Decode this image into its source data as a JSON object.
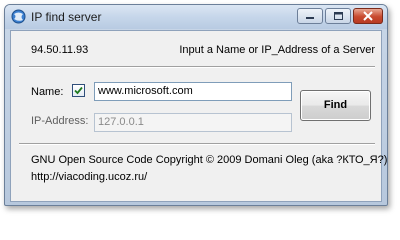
{
  "window": {
    "title": "IP find server"
  },
  "header": {
    "local_ip": "94.50.11.93",
    "hint": "Input a Name or IP_Address of a Server"
  },
  "form": {
    "name_label": "Name:",
    "name_checked": true,
    "name_value": "www.microsoft.com",
    "ip_label": "IP-Address:",
    "ip_value": "127.0.0.1",
    "find_label": "Find"
  },
  "footer": {
    "copyright": "GNU Open Source Code Copyright © 2009 Domani Oleg (aka ?КТО_Я?)",
    "link": "http://viacoding.ucoz.ru/"
  },
  "colors": {
    "accent": "#2f6fb5",
    "close_button": "#c84a2f"
  }
}
